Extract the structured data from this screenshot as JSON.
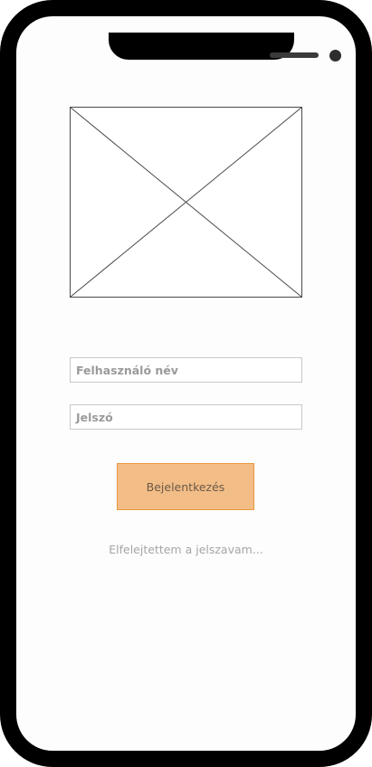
{
  "device": {
    "frame_color": "#000000",
    "screen_color": "#fdfdfd"
  },
  "login": {
    "image_icon": "image-placeholder-icon",
    "username_placeholder": "Felhasználó név",
    "password_placeholder": "Jelszó",
    "submit_label": "Bejelentkezés",
    "submit_color": "#f3bd87",
    "submit_border_color": "#e8973f",
    "forgot_password_label": "Elfelejtettem a jelszavam..."
  }
}
